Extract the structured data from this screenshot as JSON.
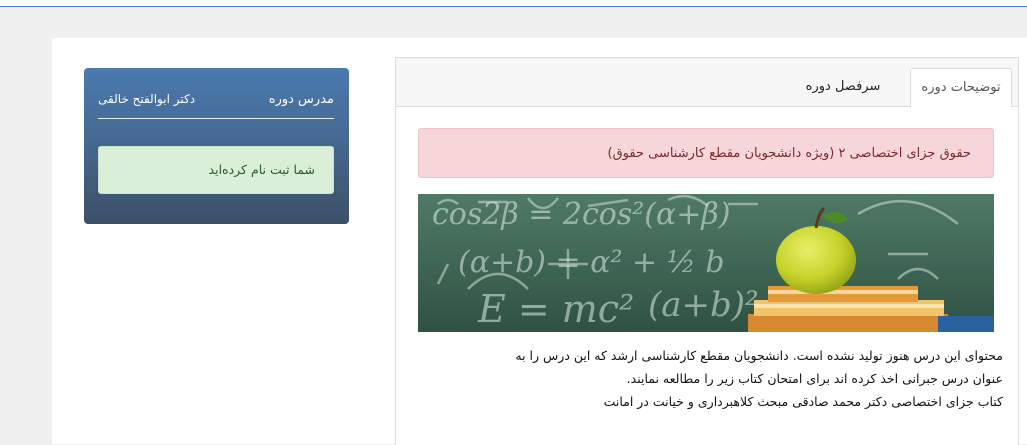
{
  "tabs": {
    "description_label": "توضیحات دوره",
    "syllabus_label": "سرفصل دوره"
  },
  "course": {
    "title": "حقوق جزای اختصاصی ۲ (ویژه دانشجویان مقطع کارشناسی حقوق)",
    "banner_formulas": [
      "cos2β = 2cos²(α+β)",
      "(α+b) = α² + ½ b",
      "E = mc²",
      "(a+b)²"
    ],
    "description_lines": [
      "محتوای این درس هنوز تولید نشده است. دانشجویان مقطع کارشناسی ارشد که این درس را به",
      "عنوان درس جبرانی اخذ کرده اند برای امتحان کتاب زیر را مطالعه نمایند.",
      "کتاب جزای اختصاصی دکتر محمد صادقی مبحث کلاهبرداری و خیانت در امانت"
    ]
  },
  "teacher": {
    "label": "مدرس دوره",
    "name": "دکتر ابوالفتح خالقی"
  },
  "enrollment": {
    "status": "شما ثبت نام کرده‌اید"
  },
  "colors": {
    "alert_bg": "#f6d6d8",
    "success_bg": "#d9efd7",
    "card_gradient_top": "#4a7ab0",
    "card_gradient_bottom": "#3c4f68"
  }
}
